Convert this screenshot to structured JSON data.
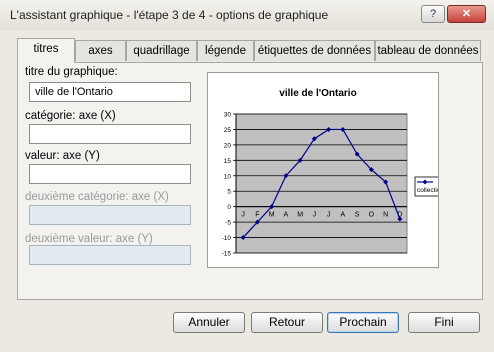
{
  "window": {
    "title": "L'assistant graphique - l'étape 3 de 4 -  options de graphique",
    "help_label": "?",
    "close_label": "✕"
  },
  "tabs": [
    {
      "label": "titres",
      "active": true
    },
    {
      "label": "axes"
    },
    {
      "label": "quadrillage"
    },
    {
      "label": "légende"
    },
    {
      "label": "étiquettes de données"
    },
    {
      "label": "tableau de données"
    }
  ],
  "form": {
    "chart_title_label": "titre du graphique:",
    "chart_title_value": "ville de l'Ontario",
    "category_x_label": "catégorie: axe (X)",
    "category_x_value": "",
    "value_y_label": "valeur: axe (Y)",
    "value_y_value": "",
    "second_category_label": "deuxième catégorie: axe (X)",
    "second_value_label": "deuxième valeur: axe (Y)"
  },
  "chart_data": {
    "type": "line",
    "title": "ville de l'Ontario",
    "categories": [
      "J",
      "F",
      "M",
      "A",
      "M",
      "J",
      "J",
      "A",
      "S",
      "O",
      "N",
      "D"
    ],
    "series": [
      {
        "name": "collection 1",
        "values": [
          -10,
          -5,
          0,
          10,
          15,
          22,
          25,
          25,
          17,
          12,
          8,
          -4
        ]
      }
    ],
    "ylim": [
      -15,
      30
    ],
    "ytick_step": 5,
    "grid": true,
    "plot_background": "#c0c0c0",
    "line_color": "#00008b",
    "legend": "right"
  },
  "buttons": {
    "cancel": "Annuler",
    "back": "Retour",
    "next": "Prochain",
    "finish": "Fini"
  }
}
